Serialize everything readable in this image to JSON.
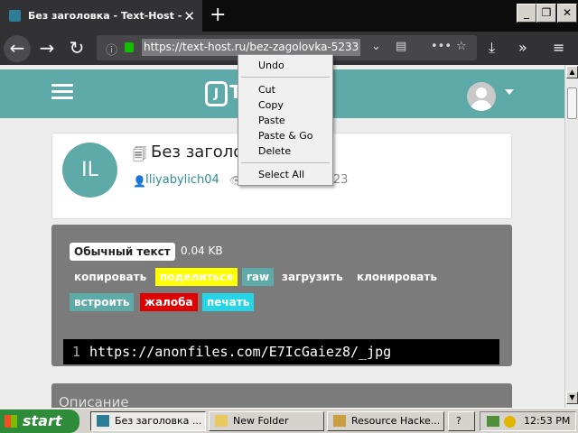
{
  "browser": {
    "tab_title": "Без заголовка - Text-Host - текс",
    "tab_close": "✕",
    "new_tab": "+",
    "url": "https://text-host.ru/bez-zagolovka-5233",
    "window_buttons": {
      "minimize": "_",
      "maximize": "❐",
      "close": "✕"
    },
    "nav": {
      "back": "←",
      "forward": "→",
      "reload": "↻"
    },
    "toolbar_icons": [
      "info-icon",
      "lock-icon",
      "dropdown-icon",
      "reader-icon",
      "page-actions-icon",
      "bookmark-star-icon",
      "download-icon",
      "overflow-icon",
      "menu-icon"
    ]
  },
  "site": {
    "logo_letter": "J",
    "logo_text": "T",
    "avatar_initials": "IL",
    "paste_title": "Без заголо",
    "author": "Iliyabylich04",
    "date": "5 Апр, 2023",
    "type_badge": "Обычный текст",
    "size": "0.04 KB",
    "buttons": [
      {
        "label": "копировать",
        "color": "#5eaaa8"
      },
      {
        "label": "поделиться",
        "color": "#ffff00"
      },
      {
        "label": "raw",
        "color": "#5eaaa8"
      },
      {
        "label": "загрузить",
        "color": "#7b7b7b"
      },
      {
        "label": "клонировать",
        "color": "#7b7b7b"
      },
      {
        "label": "встроить",
        "color": "#5eaaa8"
      },
      {
        "label": "жалоба",
        "color": "#e00000"
      },
      {
        "label": "печать",
        "color": "#27d6e6"
      }
    ],
    "code_line_number": "1",
    "code_text": "https://anonfiles.com/E7IcGaiez8/_jpg",
    "next_section_title": "Описание"
  },
  "context_menu": {
    "items": [
      "Undo",
      "Cut",
      "Copy",
      "Paste",
      "Paste & Go",
      "Delete",
      "Select All"
    ]
  },
  "taskbar": {
    "start_label": "start",
    "tasks": [
      "Без заголовка ...",
      "New Folder",
      "Resource Hacke...",
      "?"
    ],
    "clock": "12:53 PM"
  },
  "colors": {
    "accent": "#5eaaa8",
    "chrome_dark": "#323234"
  }
}
